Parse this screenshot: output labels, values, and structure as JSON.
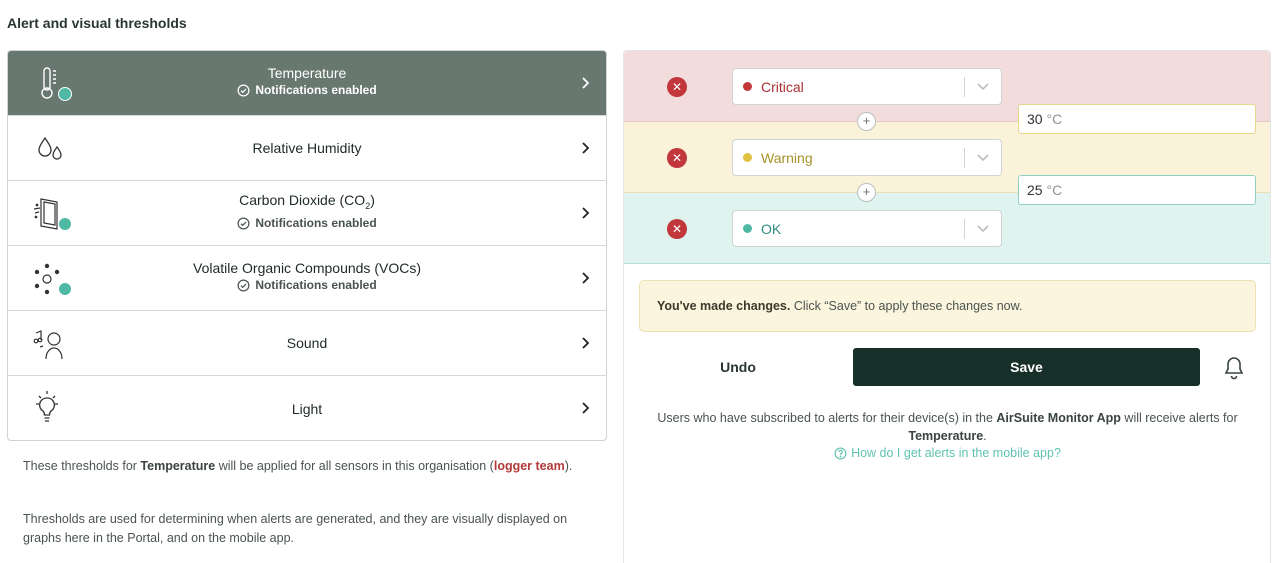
{
  "page": {
    "title": "Alert and visual thresholds"
  },
  "sensors": [
    {
      "name": "Temperature",
      "notification": "Notifications enabled",
      "icon": "thermometer-icon",
      "active": true
    },
    {
      "name": "Relative Humidity",
      "notification": "",
      "icon": "droplets-icon",
      "active": false
    },
    {
      "name_prefix": "Carbon Dioxide (CO",
      "name_sub": "2",
      "name_suffix": ")",
      "notification": "Notifications enabled",
      "icon": "window-co2-icon",
      "active": false
    },
    {
      "name": "Volatile Organic Compounds (VOCs)",
      "notification": "Notifications enabled",
      "icon": "voc-dots-icon",
      "active": false
    },
    {
      "name": "Sound",
      "notification": "",
      "icon": "sound-icon",
      "active": false
    },
    {
      "name": "Light",
      "notification": "",
      "icon": "lightbulb-icon",
      "active": false
    }
  ],
  "description": {
    "line1_prefix": "These thresholds for ",
    "line1_sensor": "Temperature",
    "line1_mid": " will be applied for all sensors in this organisation (",
    "line1_org": "logger team",
    "line1_suffix": ").",
    "line2": "Thresholds are used for determining when alerts are generated, and they are visually displayed on graphs here in the Portal, and on the mobile app."
  },
  "thresholds": {
    "levels": [
      {
        "label": "Critical",
        "color": "#c2373b"
      },
      {
        "label": "Warning",
        "color": "#e0c340"
      },
      {
        "label": "OK",
        "color": "#4fb9a6"
      }
    ],
    "values": [
      {
        "value": "30",
        "unit": "°C"
      },
      {
        "value": "25",
        "unit": "°C"
      }
    ]
  },
  "notice": {
    "bold": "You've made changes.",
    "text": " Click “Save” to apply these changes now."
  },
  "actions": {
    "undo": "Undo",
    "save": "Save"
  },
  "help": {
    "prefix": "Users who have subscribed to alerts for their device(s) in the ",
    "app": "AirSuite Monitor App",
    "mid": " will receive alerts for ",
    "sensor": "Temperature",
    "suffix": ".",
    "link": "How do I get alerts in the mobile app?"
  },
  "colors": {
    "active_row": "#68776f",
    "save_button": "#18302a",
    "link": "#5fc2b0",
    "org": "#b43a3a"
  }
}
